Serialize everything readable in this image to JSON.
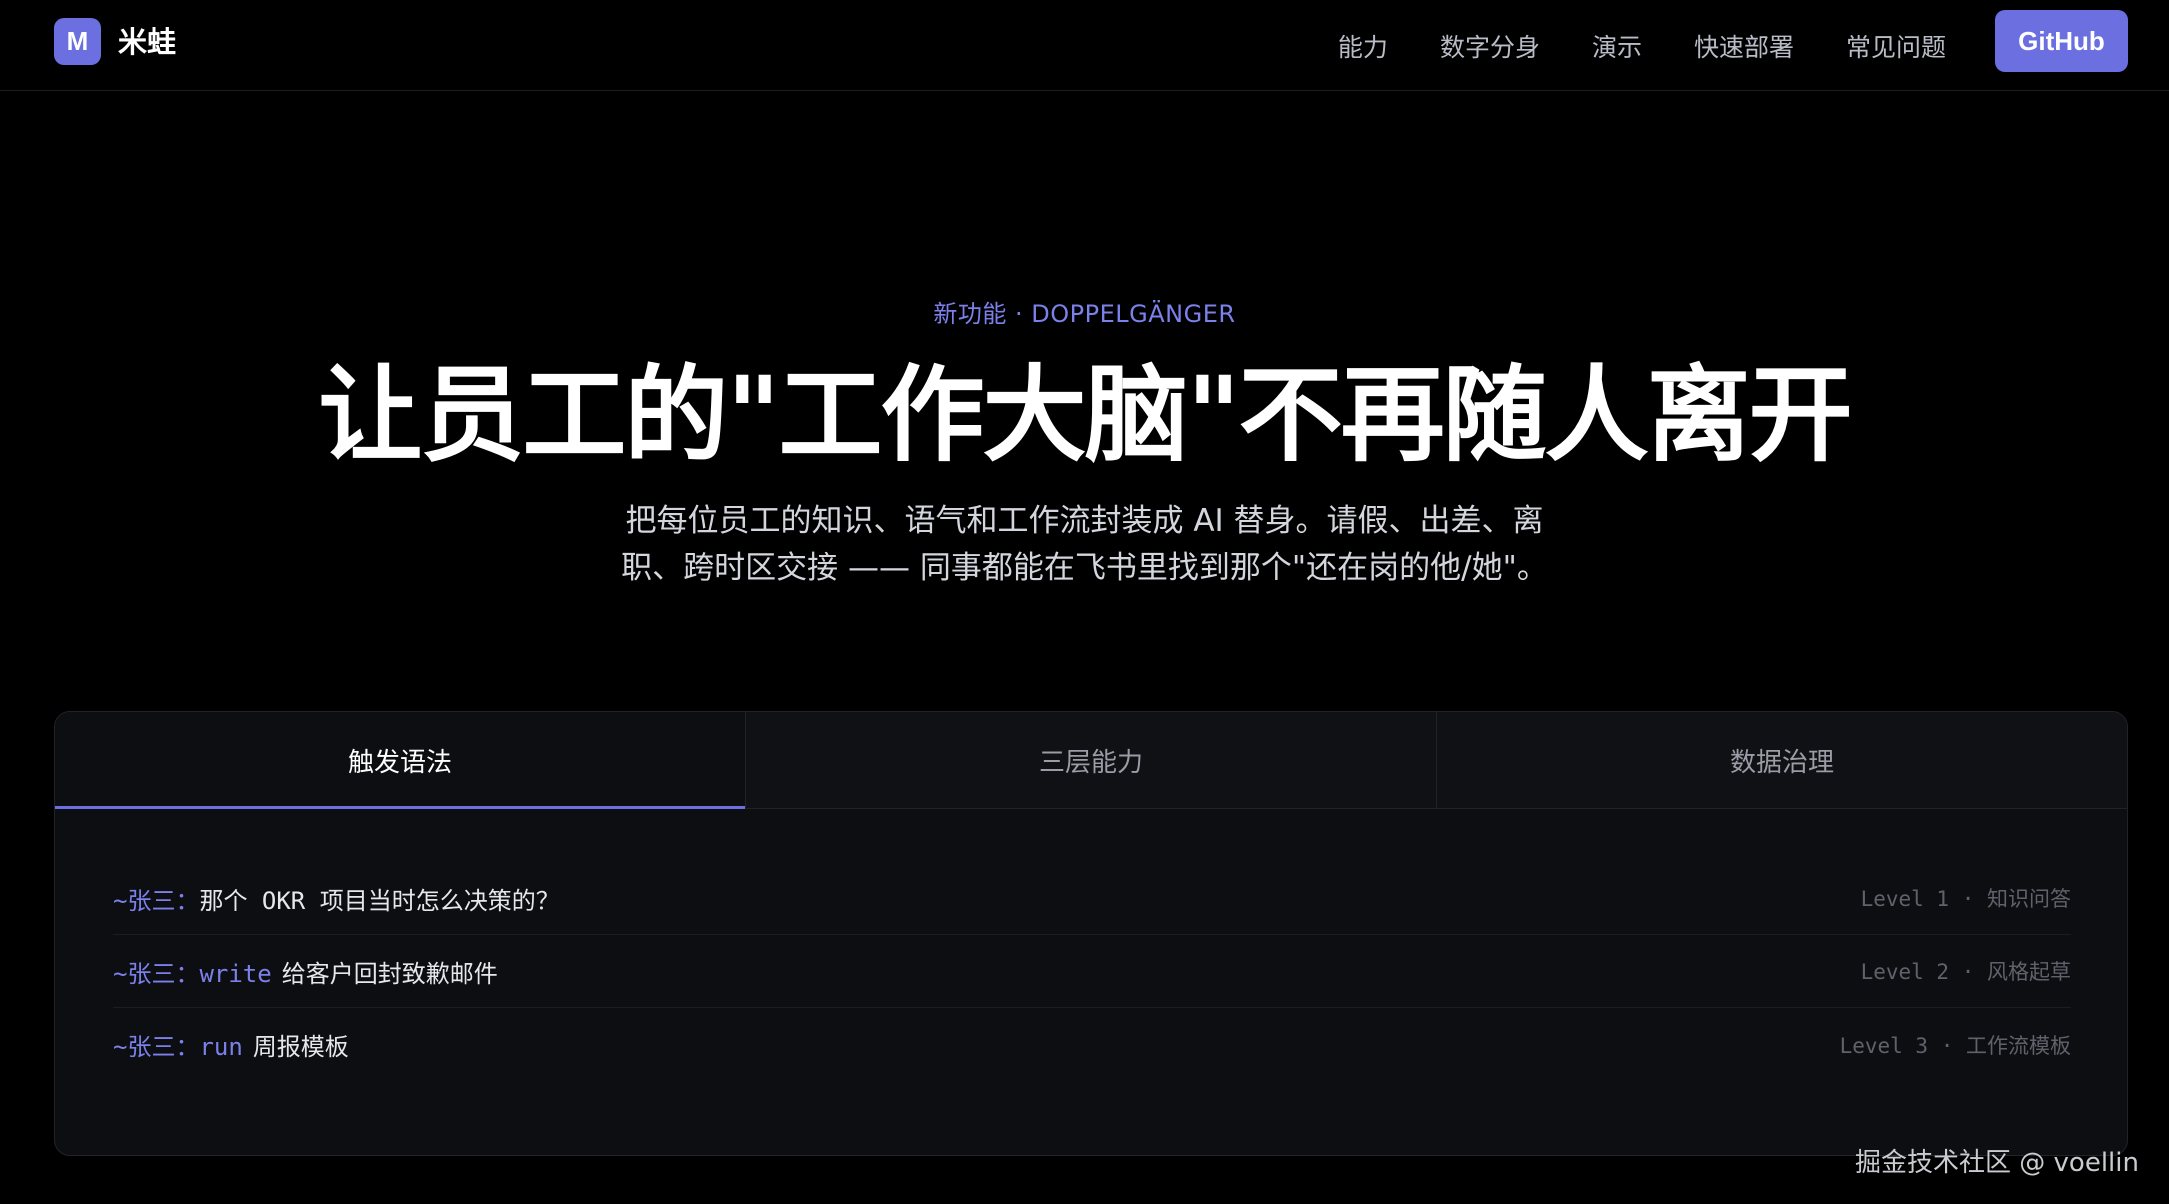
{
  "nav": {
    "logo_letter": "M",
    "brand": "米蛙",
    "links": [
      "能力",
      "数字分身",
      "演示",
      "快速部署",
      "常见问题"
    ],
    "github_label": "GitHub"
  },
  "hero": {
    "eyebrow": "新功能 · DOPPELGÄNGER",
    "title": "让员工的\"工作大脑\"不再随人离开",
    "subtitle_line1": "把每位员工的知识、语气和工作流封装成 AI 替身。请假、出差、离",
    "subtitle_line2": "职、跨时区交接 —— 同事都能在飞书里找到那个\"还在岗的他/她\"。"
  },
  "panel": {
    "tabs": [
      {
        "label": "触发语法",
        "active": true
      },
      {
        "label": "三层能力",
        "active": false
      },
      {
        "label": "数据治理",
        "active": false
      }
    ],
    "rows": [
      {
        "prefix": "~张三：",
        "keyword": "",
        "text": "那个 OKR 项目当时怎么决策的？",
        "meta": "Level 1 · 知识问答"
      },
      {
        "prefix": "~张三：",
        "keyword": "write",
        "text": "给客户回封致歉邮件",
        "meta": "Level 2 · 风格起草"
      },
      {
        "prefix": "~张三：",
        "keyword": "run",
        "text": "周报模板",
        "meta": "Level 3 · 工作流模板"
      }
    ]
  },
  "watermark": "掘金技术社区 @ voellin",
  "colors": {
    "accent": "#6b6fe0",
    "background": "#000000",
    "panel": "#0d0e11"
  }
}
